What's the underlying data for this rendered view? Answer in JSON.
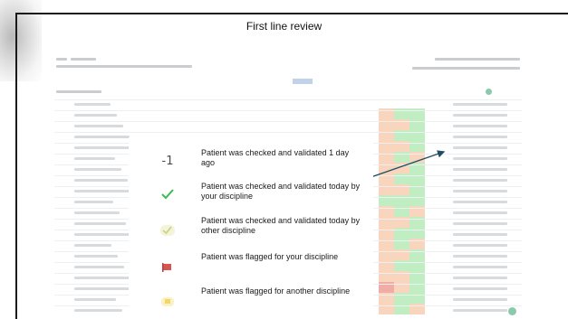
{
  "slide": {
    "title": "First line review"
  },
  "legend": {
    "items": [
      {
        "icon": "minus-one-badge",
        "symbol": "-1",
        "text": "Patient was checked and validated 1 day ago"
      },
      {
        "icon": "green-check-icon",
        "color": "#3cba54",
        "text": "Patient was checked and validated today by your discipline"
      },
      {
        "icon": "faint-check-icon",
        "color": "#c9d48a",
        "text": "Patient was checked and validated today by other discipline"
      },
      {
        "icon": "red-flag-icon",
        "color": "#d9534f",
        "text": "Patient was flagged for your discipline"
      },
      {
        "icon": "yellow-flag-icon",
        "color": "#f2d56b",
        "text": "Patient was flagged for another discipline"
      }
    ]
  },
  "colors": {
    "status_orange": "#f3b486",
    "status_green": "#8ee08f",
    "status_red": "#e86a5f",
    "arrow": "#1f4e64"
  }
}
